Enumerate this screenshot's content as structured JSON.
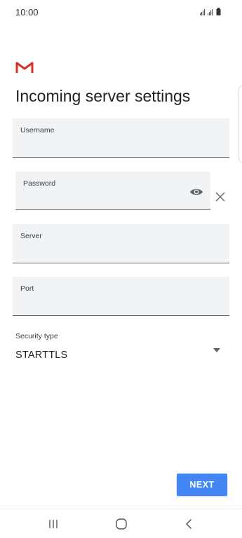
{
  "status_bar": {
    "time": "10:00",
    "icons": [
      "signal-icon",
      "signal-icon",
      "battery-icon"
    ]
  },
  "header": {
    "logo": "gmail-logo",
    "title": "Incoming server settings"
  },
  "form": {
    "username": {
      "label": "Username",
      "value": ""
    },
    "password": {
      "label": "Password",
      "value": "",
      "toggle_icon": "eye-icon",
      "clear_icon": "close-icon"
    },
    "server": {
      "label": "Server",
      "value": ""
    },
    "port": {
      "label": "Port",
      "value": ""
    },
    "security": {
      "label": "Security type",
      "selected": "STARTTLS",
      "icon": "dropdown-arrow-icon"
    }
  },
  "actions": {
    "next_label": "NEXT"
  },
  "nav_bar": {
    "buttons": [
      "recents-icon",
      "home-icon",
      "back-icon"
    ]
  },
  "colors": {
    "accent": "#4285f4",
    "gmail_red": "#d93025",
    "field_bg": "#f1f3f4"
  }
}
